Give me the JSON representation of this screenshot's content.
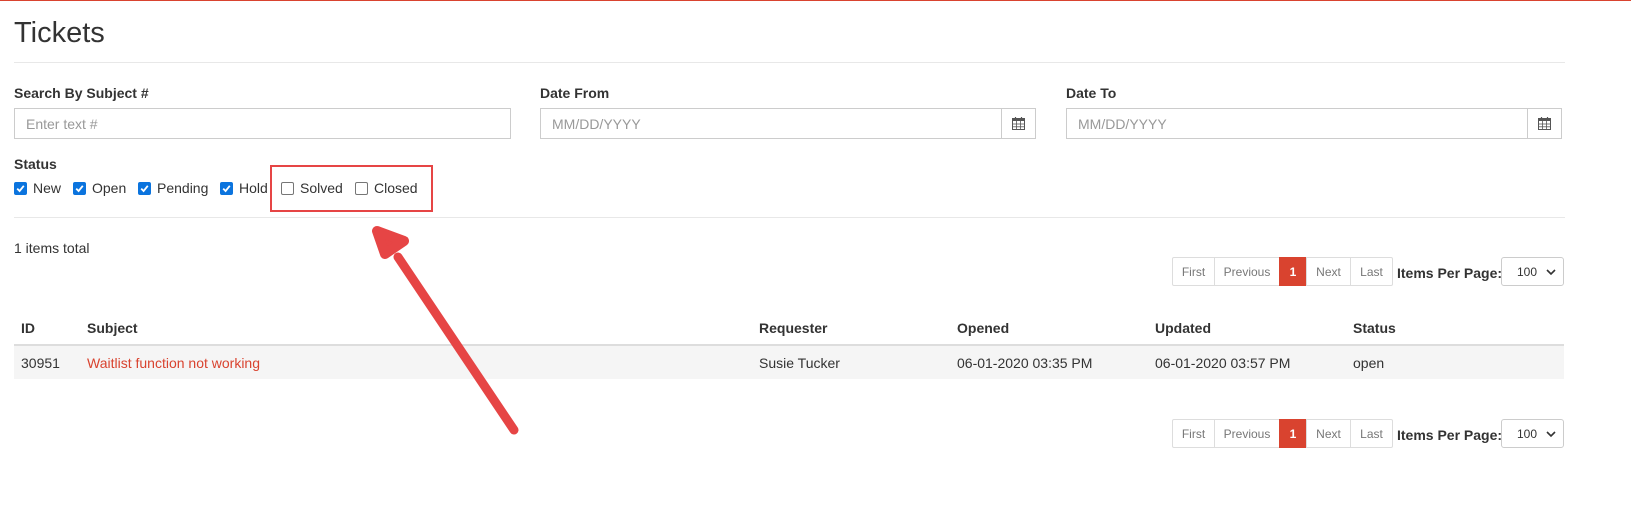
{
  "page": {
    "title": "Tickets"
  },
  "filters": {
    "search": {
      "label": "Search By Subject #",
      "placeholder": "Enter text #",
      "value": ""
    },
    "date_from": {
      "label": "Date From",
      "placeholder": "MM/DD/YYYY",
      "value": ""
    },
    "date_to": {
      "label": "Date To",
      "placeholder": "MM/DD/YYYY",
      "value": ""
    },
    "status": {
      "label": "Status",
      "options": [
        {
          "label": "New",
          "checked": true
        },
        {
          "label": "Open",
          "checked": true
        },
        {
          "label": "Pending",
          "checked": true
        },
        {
          "label": "Hold",
          "checked": true
        },
        {
          "label": "Solved",
          "checked": false
        },
        {
          "label": "Closed",
          "checked": false
        }
      ]
    }
  },
  "summary": {
    "total_text": "1 items total"
  },
  "pagination": {
    "buttons": [
      "First",
      "Previous",
      "1",
      "Next",
      "Last"
    ],
    "current_page": "1",
    "items_per_page_label": "Items Per Page:",
    "items_per_page_value": "100"
  },
  "table": {
    "columns": [
      "ID",
      "Subject",
      "Requester",
      "Opened",
      "Updated",
      "Status"
    ],
    "rows": [
      {
        "id": "30951",
        "subject": "Waitlist function not working",
        "requester": "Susie Tucker",
        "opened": "06-01-2020 03:35 PM",
        "updated": "06-01-2020 03:57 PM",
        "status": "open"
      }
    ]
  },
  "colors": {
    "accent": "#d9432f",
    "checkbox": "#0b74de",
    "annotation": "#e64545",
    "row_background": "#f5f5f5"
  },
  "annotation": {
    "highlight_box": true,
    "arrow": true
  }
}
